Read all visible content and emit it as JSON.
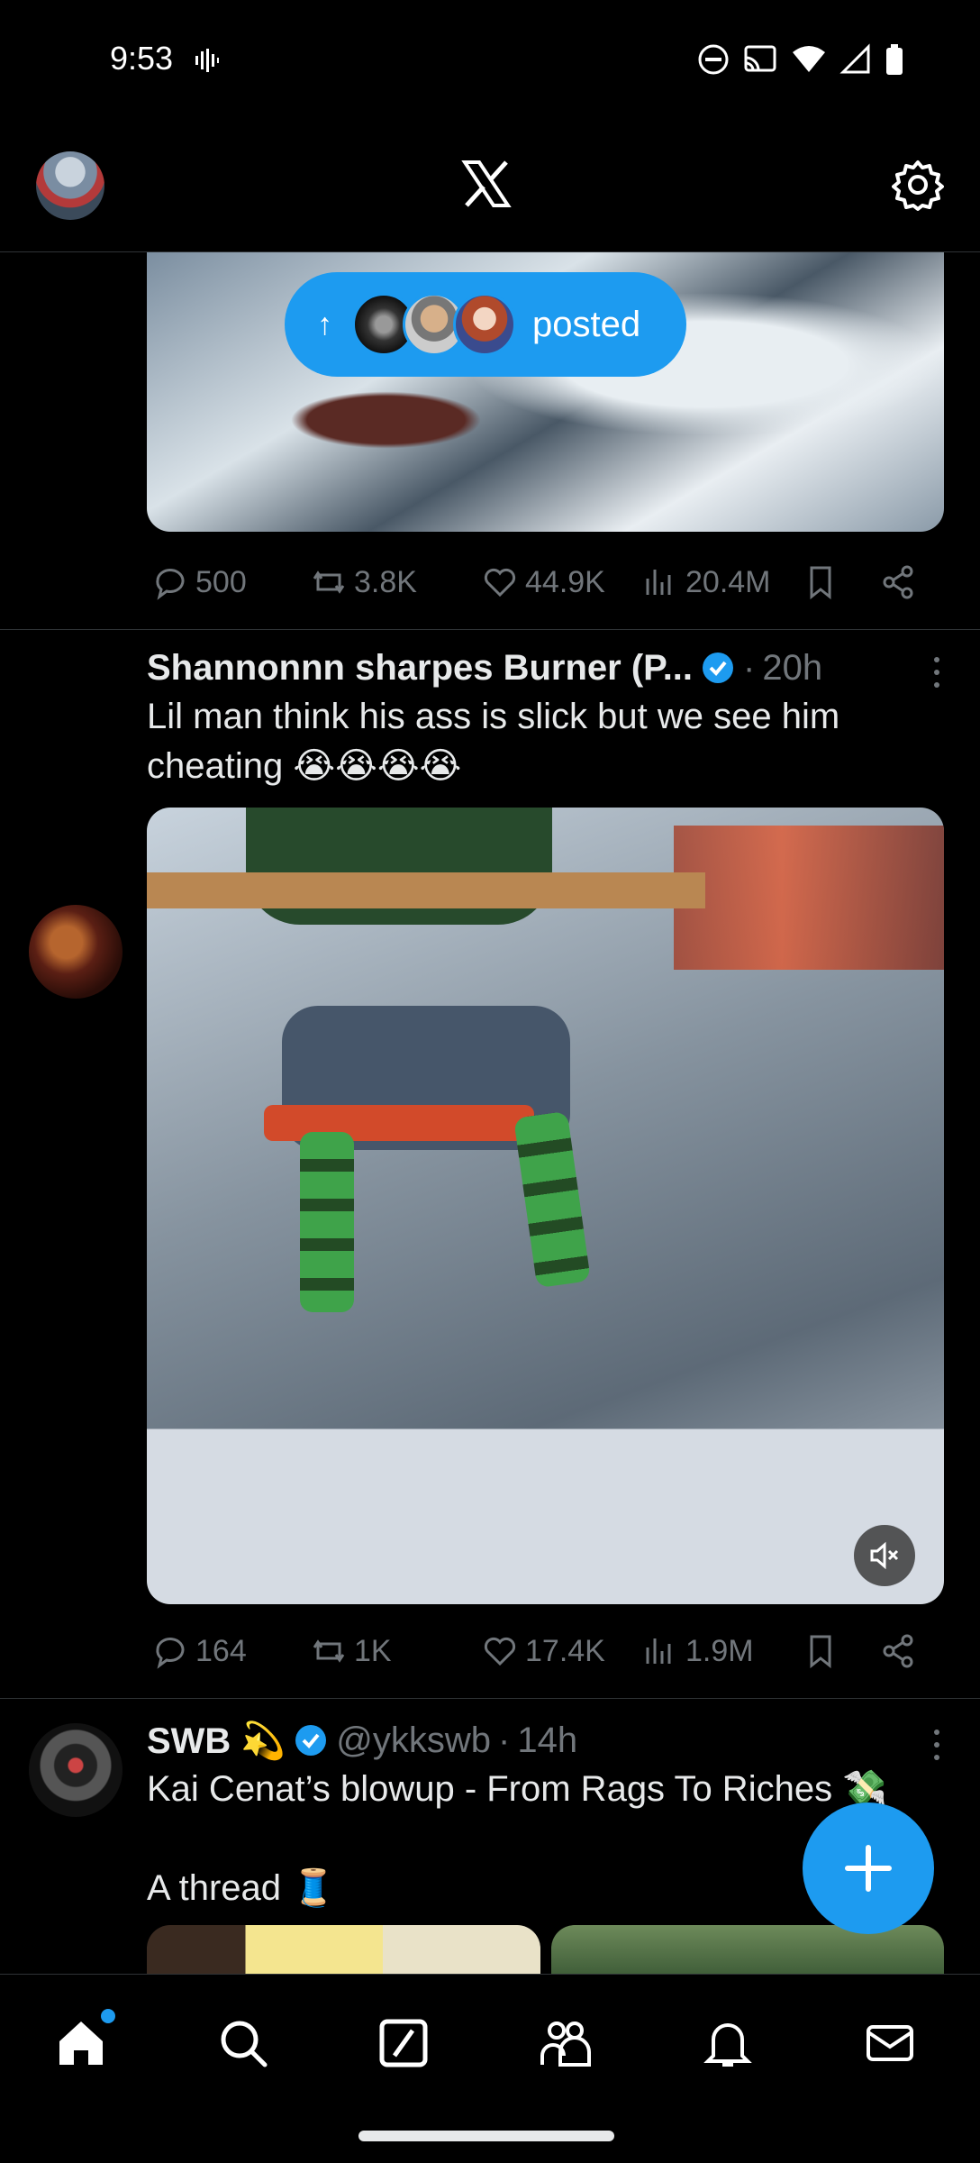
{
  "status_bar": {
    "time": "9:53"
  },
  "header": {
    "logo": "x-logo",
    "settings_icon": "gear-icon"
  },
  "posted_pill": {
    "label": "posted"
  },
  "post_top": {
    "actions": {
      "replies": "500",
      "reposts": "3.8K",
      "likes": "44.9K",
      "views": "20.4M"
    }
  },
  "post_shannon": {
    "author": "Shannonnn sharpes Burner (P...",
    "time": "20h",
    "text": "Lil man think his ass is slick but we see him cheating 😭😭😭😭",
    "actions": {
      "replies": "164",
      "reposts": "1K",
      "likes": "17.4K",
      "views": "1.9M"
    }
  },
  "post_swb": {
    "author": "SWB 💫",
    "handle": "@ykkswb",
    "time": "14h",
    "line1": "Kai Cenat’s blowup - From Rags To Riches 💸",
    "line2": "A thread 🧵"
  },
  "colors": {
    "accent": "#1d9bf0",
    "muted": "#71767b",
    "text": "#e7e9ea",
    "background": "#000000"
  },
  "bottom_nav": {
    "items": [
      "home-icon",
      "search-icon",
      "grok-icon",
      "communities-icon",
      "notifications-icon",
      "messages-icon"
    ]
  }
}
